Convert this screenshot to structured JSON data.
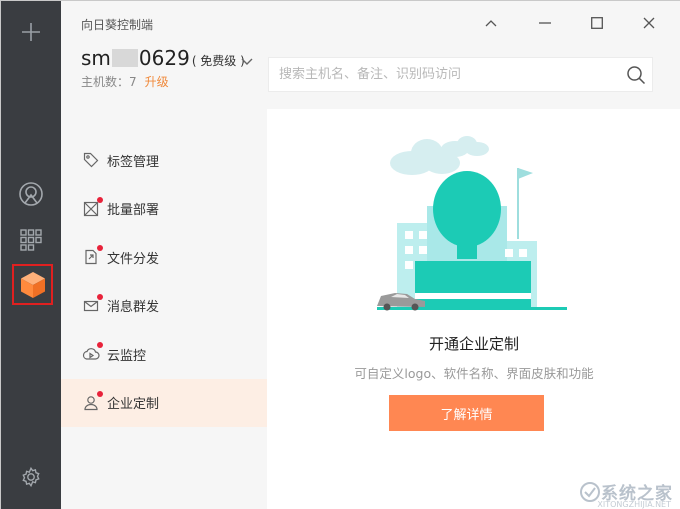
{
  "app": {
    "title": "向日葵控制端"
  },
  "account": {
    "name_prefix": "sm",
    "name_suffix": "0629",
    "plan": "( 免费级 )",
    "host_count": "主机数：7",
    "upgrade": "升级"
  },
  "search": {
    "placeholder": "搜索主机名、备注、识别码访问"
  },
  "rail": {
    "icons": [
      "plus-icon",
      "remote-control-icon",
      "apps-grid-icon",
      "enterprise-cube-icon",
      "gear-icon"
    ],
    "active_icon_color": "#ff8a3d",
    "highlight_border": "#e02020"
  },
  "nav": {
    "items": [
      {
        "label": "标签管理",
        "icon": "tag-icon",
        "dot": false
      },
      {
        "label": "批量部署",
        "icon": "batch-deploy-icon",
        "dot": true
      },
      {
        "label": "文件分发",
        "icon": "file-distribute-icon",
        "dot": true
      },
      {
        "label": "消息群发",
        "icon": "message-icon",
        "dot": true
      },
      {
        "label": "云监控",
        "icon": "cloud-monitor-icon",
        "dot": true
      },
      {
        "label": "企业定制",
        "icon": "enterprise-icon",
        "dot": true
      }
    ],
    "active_index": 5
  },
  "main": {
    "heading": "开通企业定制",
    "description": "可自定义logo、软件名称、界面皮肤和功能",
    "button": "了解详情"
  },
  "watermark": {
    "text": "系统之家",
    "url": "XITONGZHIJIA.NET"
  },
  "colors": {
    "rail": "#3a3d41",
    "accent": "#ff8752",
    "teal": "#1ccbb5",
    "nav_active_bg": "#fdeee4",
    "dot": "#e8223a"
  }
}
